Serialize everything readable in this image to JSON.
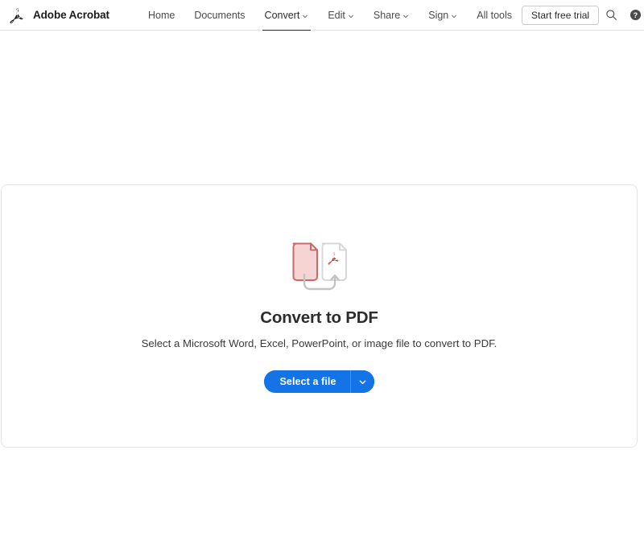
{
  "header": {
    "brand": {
      "logo_icon": "adobe-acrobat-logo-icon",
      "name": "Adobe Acrobat"
    },
    "nav": [
      {
        "label": "Home",
        "has_caret": false,
        "active": false
      },
      {
        "label": "Documents",
        "has_caret": false,
        "active": false
      },
      {
        "label": "Convert",
        "has_caret": true,
        "active": true
      },
      {
        "label": "Edit",
        "has_caret": true,
        "active": false
      },
      {
        "label": "Share",
        "has_caret": true,
        "active": false
      },
      {
        "label": "Sign",
        "has_caret": true,
        "active": false
      },
      {
        "label": "All tools",
        "has_caret": false,
        "active": false
      }
    ],
    "trial_button_label": "Start free trial",
    "icons": {
      "search": "search-icon",
      "help": "help-icon",
      "notifications": "bell-icon",
      "avatar": "user-avatar"
    },
    "colors": {
      "active_underline": "#2c2c2c",
      "avatar_outer": "#27c8f5",
      "avatar_inner": "#0aa2c9"
    }
  },
  "main": {
    "icon_name": "convert-to-pdf-icon",
    "title": "Convert to PDF",
    "subtitle": "Select a Microsoft Word, Excel, PowerPoint, or image file to convert to PDF.",
    "primary_button": {
      "label": "Select a file",
      "dropdown_icon": "chevron-down-icon",
      "color": "#1473e6"
    },
    "icon_colors": {
      "source_doc_fill": "#f6d2d2",
      "source_doc_stroke": "#c96a6a",
      "target_doc_stroke": "#d8d8d8",
      "pdf_glyph": "#b5312a",
      "arrow": "#bdbdbd"
    }
  }
}
